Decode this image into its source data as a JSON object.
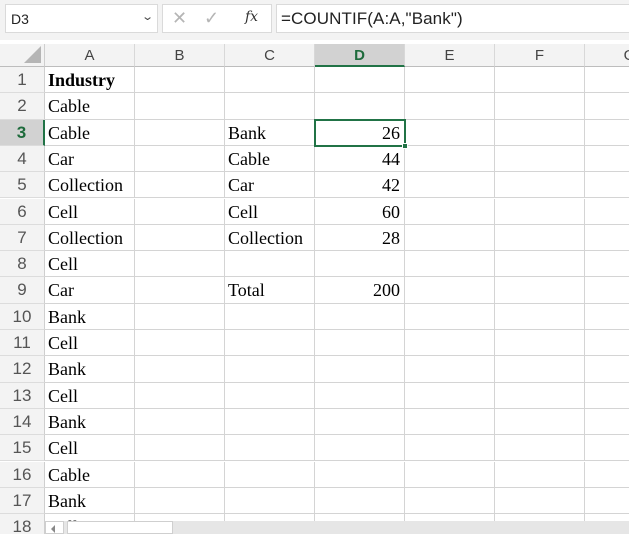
{
  "formula_bar": {
    "name_box": "D3",
    "cancel_icon": "✕",
    "enter_icon": "✓",
    "fx_label": "fx",
    "formula": "=COUNTIF(A:A,\"Bank\")"
  },
  "columns": [
    "A",
    "B",
    "C",
    "D",
    "E",
    "F",
    "G"
  ],
  "active_cell": {
    "column": "D",
    "row": 3
  },
  "rows": [
    {
      "n": "1",
      "A": "Industry",
      "C": "",
      "D": ""
    },
    {
      "n": "2",
      "A": "Cable",
      "C": "",
      "D": ""
    },
    {
      "n": "3",
      "A": "Cable",
      "C": "Bank",
      "D": "26"
    },
    {
      "n": "4",
      "A": "Car",
      "C": "Cable",
      "D": "44"
    },
    {
      "n": "5",
      "A": "Collection",
      "C": "Car",
      "D": "42"
    },
    {
      "n": "6",
      "A": "Cell",
      "C": "Cell",
      "D": "60"
    },
    {
      "n": "7",
      "A": "Collection",
      "C": "Collection",
      "D": "28"
    },
    {
      "n": "8",
      "A": "Cell",
      "C": "",
      "D": ""
    },
    {
      "n": "9",
      "A": "Car",
      "C": "Total",
      "D": "200"
    },
    {
      "n": "10",
      "A": "Bank",
      "C": "",
      "D": ""
    },
    {
      "n": "11",
      "A": "Cell",
      "C": "",
      "D": ""
    },
    {
      "n": "12",
      "A": "Bank",
      "C": "",
      "D": ""
    },
    {
      "n": "13",
      "A": "Cell",
      "C": "",
      "D": ""
    },
    {
      "n": "14",
      "A": "Bank",
      "C": "",
      "D": ""
    },
    {
      "n": "15",
      "A": "Cell",
      "C": "",
      "D": ""
    },
    {
      "n": "16",
      "A": "Cable",
      "C": "",
      "D": ""
    },
    {
      "n": "17",
      "A": "Bank",
      "C": "",
      "D": ""
    },
    {
      "n": "18",
      "A": "Cell",
      "C": "",
      "D": ""
    }
  ],
  "colors": {
    "accent": "#217346",
    "header_bg": "#f3f3f3",
    "gridline": "#d4d4d4"
  }
}
